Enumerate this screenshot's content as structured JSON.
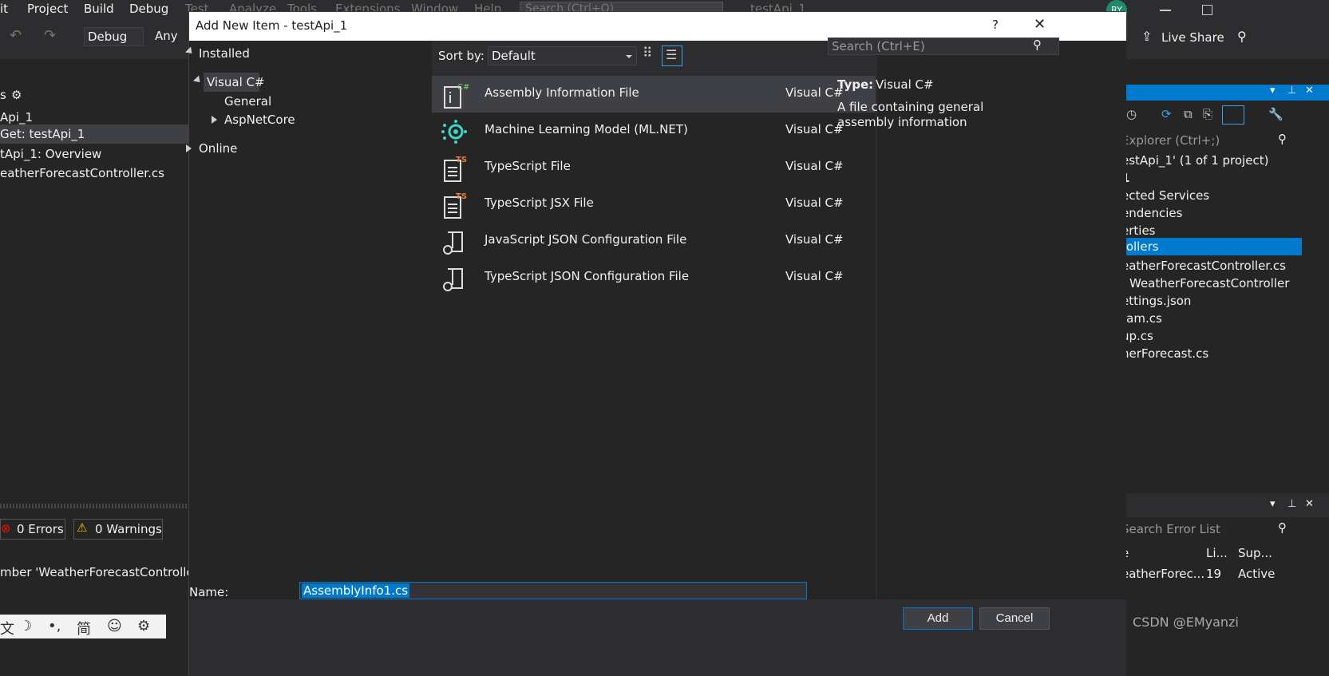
{
  "ide": {
    "menu": [
      "it",
      "Project",
      "Build",
      "Debug",
      "Test",
      "Analyze",
      "Tools",
      "Extensions",
      "Window",
      "Help"
    ],
    "search_placeholder": "Search (Ctrl+Q)",
    "solution_tab": "testApi_1",
    "avatar_initials": "RY",
    "toolbar_config": "Debug",
    "toolbar_platform": "Any",
    "live_share": "Live Share",
    "left_panel_title": "s",
    "left_items": [
      "Api_1",
      "Get: testApi_1",
      "tApi_1: Overview",
      "eatherForecastController.cs"
    ],
    "error_count": "0 Errors",
    "warning_count": "0 Warnings",
    "error_message": "mber 'WeatherForecastControlle",
    "ime_glyphs": [
      "文",
      "☽",
      "•,",
      "简",
      "☺",
      "⚙"
    ]
  },
  "solution_explorer": {
    "search_placeholder": "Explorer (Ctrl+;)",
    "items": [
      "estApi_1' (1 of 1 project)",
      "1",
      "ected Services",
      "endencies",
      "erties",
      "rollers",
      "eatherForecastController.cs",
      "WeatherForecastController",
      "ettings.json",
      "ram.cs",
      "up.cs",
      "herForecast.cs"
    ],
    "selected_index": 5
  },
  "error_list": {
    "search_placeholder": "Search Error List",
    "columns": [
      "e",
      "Li...",
      "Sup..."
    ],
    "row": [
      "eatherForec...",
      "19",
      "Active"
    ]
  },
  "watermark": "CSDN @EMyanzi",
  "dialog": {
    "title": "Add New Item - testApi_1",
    "help": "?",
    "close": "✕",
    "tree": {
      "installed": "Installed",
      "visual_csharp": "Visual C#",
      "general": "General",
      "aspnetcore": "AspNetCore",
      "online": "Online"
    },
    "sort_label": "Sort by:",
    "sort_value": "Default",
    "search_placeholder": "Search (Ctrl+E)",
    "items": [
      {
        "name": "Assembly Information File",
        "lang": "Visual C#",
        "icon": "assembly-info-icon"
      },
      {
        "name": "Machine Learning Model (ML.NET)",
        "lang": "Visual C#",
        "icon": "ml-model-icon"
      },
      {
        "name": "TypeScript File",
        "lang": "Visual C#",
        "icon": "typescript-file-icon"
      },
      {
        "name": "TypeScript JSX File",
        "lang": "Visual C#",
        "icon": "typescript-jsx-icon"
      },
      {
        "name": "JavaScript JSON Configuration File",
        "lang": "Visual C#",
        "icon": "json-config-icon"
      },
      {
        "name": "TypeScript JSON Configuration File",
        "lang": "Visual C#",
        "icon": "json-config-icon"
      }
    ],
    "selected_index": 0,
    "info_type_label": "Type:",
    "info_type_value": "Visual C#",
    "info_description": "A file containing general assembly information",
    "name_label": "Name:",
    "name_value": "AssemblyInfo1.cs",
    "add_button": "Add",
    "cancel_button": "Cancel"
  },
  "colors": {
    "ide_bg": "#2d2d30",
    "panel_bg": "#252526",
    "accent": "#007acc",
    "selection": "#3f3f46"
  }
}
